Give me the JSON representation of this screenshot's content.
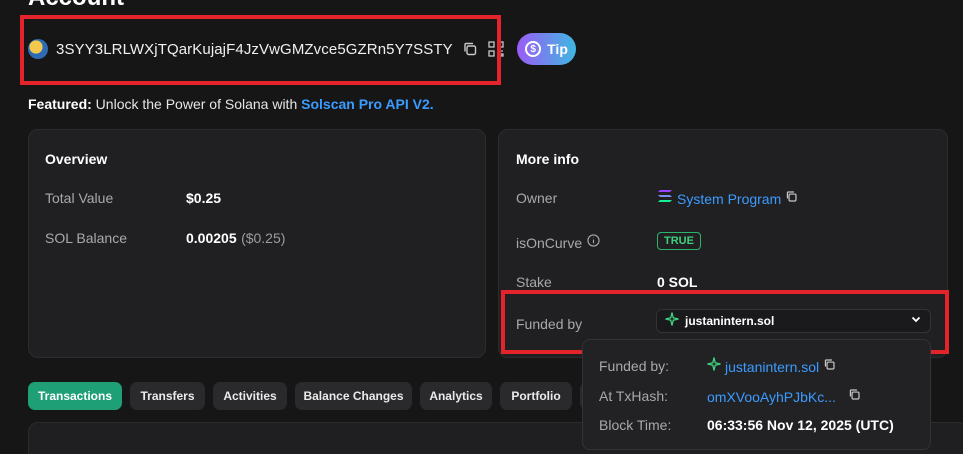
{
  "page": {
    "heading": "Account"
  },
  "account": {
    "address": "3SYY3LRLWXjTQarKujajF4JzVwGMZvce5GZRn5Y7SSTY",
    "tip_label": "Tip",
    "tip_symbol": "$"
  },
  "featured": {
    "prefix": "Featured:",
    "text": " Unlock the Power of Solana with ",
    "link": "Solscan Pro API V2."
  },
  "overview": {
    "title": "Overview",
    "total_value_label": "Total Value",
    "total_value": "$0.25",
    "sol_balance_label": "SOL Balance",
    "sol_balance": "0.00205",
    "sol_balance_usd": "($0.25)"
  },
  "more_info": {
    "title": "More info",
    "owner_label": "Owner",
    "owner_value": "System Program",
    "is_on_curve_label": "isOnCurve",
    "is_on_curve_value": "TRUE",
    "stake_label": "Stake",
    "stake_value": "0 SOL",
    "funded_by_label": "Funded by",
    "funded_by_value": "justanintern.sol"
  },
  "popover": {
    "funded_by_label": "Funded by:",
    "funded_by_value": "justanintern.sol",
    "tx_hash_label": "At TxHash:",
    "tx_hash_value": "omXVooAyhPJbKc...",
    "block_time_label": "Block Time:",
    "block_time_value": "06:33:56 Nov 12, 2025 (UTC)"
  },
  "tabs": [
    {
      "label": "Transactions",
      "active": true
    },
    {
      "label": "Transfers"
    },
    {
      "label": "Activities"
    },
    {
      "label": "Balance Changes"
    },
    {
      "label": "Analytics"
    },
    {
      "label": "Portfolio"
    }
  ],
  "colors": {
    "accent_green": "#1f9f76",
    "link_blue": "#3b9cff",
    "highlight_red": "#e3242b"
  },
  "icons": [
    "copy-icon",
    "qr-code-icon",
    "dollar-coin-icon",
    "info-icon",
    "solana-logo-icon",
    "sparkle-icon",
    "chevron-down-icon"
  ]
}
